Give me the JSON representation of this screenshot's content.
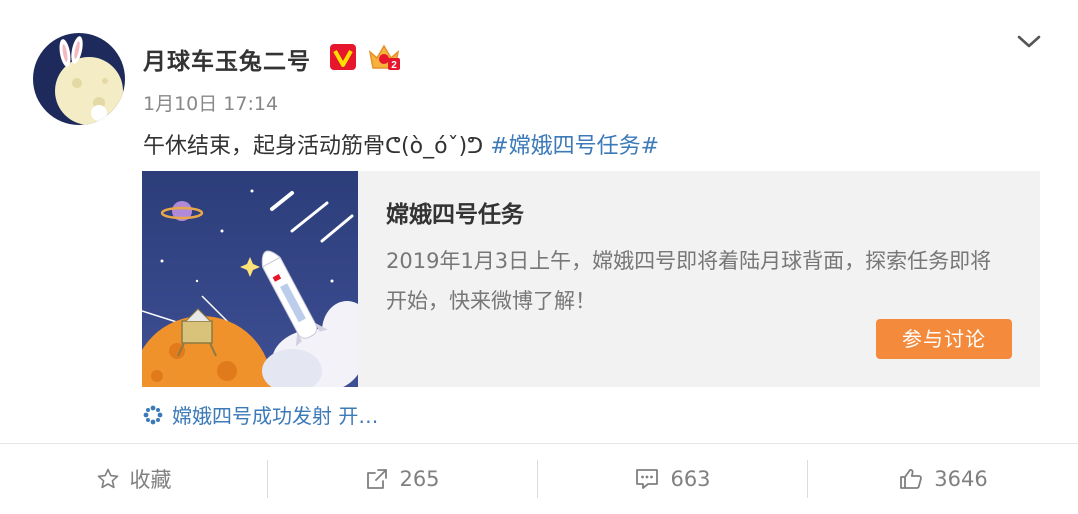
{
  "post": {
    "username": "月球车玉兔二号",
    "timestamp": "1月10日 17:14",
    "text": "午休结束，起身活动筋骨ᕦ(ò_óˇ)ᕤ ",
    "hashtag": "#嫦娥四号任务#"
  },
  "topic_card": {
    "title": "嫦娥四号任务",
    "description": "2019年1月3日上午，嫦娥四号即将着陆月球背面，探索任务即将开始，快来微博了解！",
    "button_label": "参与讨论"
  },
  "location": {
    "label": "嫦娥四号成功发射 开…"
  },
  "actions": {
    "favorite_label": "收藏",
    "repost_count": "265",
    "comment_count": "663",
    "like_count": "3646"
  },
  "colors": {
    "link": "#3d7ab8",
    "accent_button": "#f48b3c",
    "verified_badge": "#e6162d"
  }
}
